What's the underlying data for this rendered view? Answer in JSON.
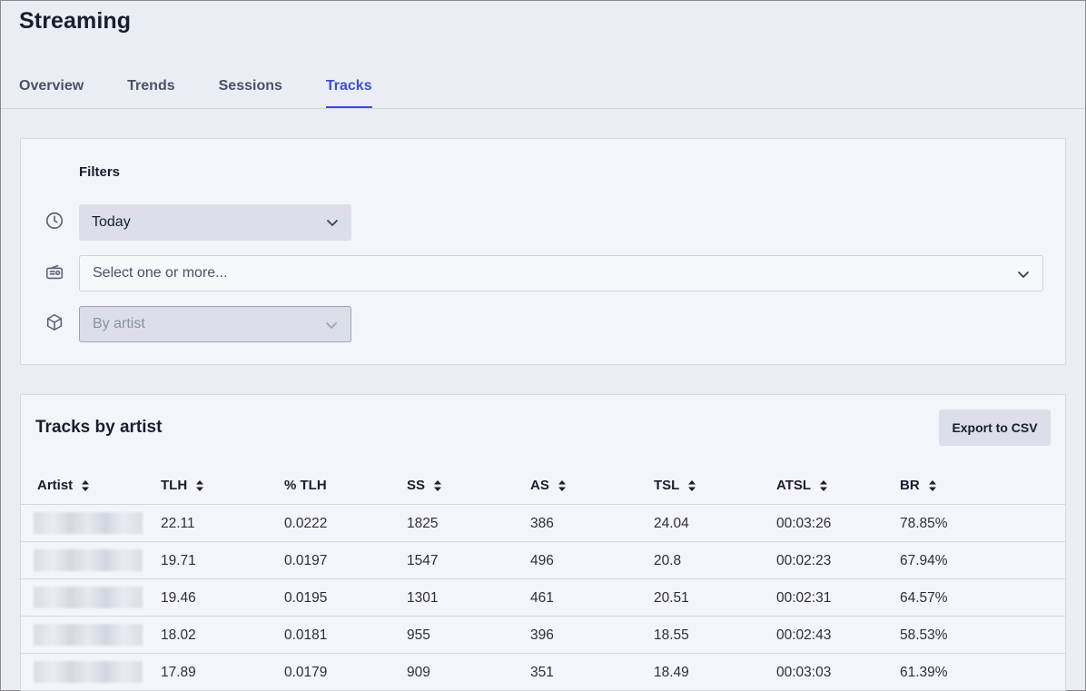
{
  "page": {
    "title": "Streaming"
  },
  "tabs": [
    {
      "label": "Overview"
    },
    {
      "label": "Trends"
    },
    {
      "label": "Sessions"
    },
    {
      "label": "Tracks",
      "active": true
    }
  ],
  "filters": {
    "title": "Filters",
    "date": {
      "value": "Today",
      "icon": "clock-icon"
    },
    "stations": {
      "placeholder": "Select one or more...",
      "icon": "radio-icon"
    },
    "group": {
      "value": "By artist",
      "icon": "cube-icon",
      "disabled": true
    }
  },
  "table": {
    "title": "Tracks by artist",
    "export_label": "Export to CSV",
    "columns": [
      {
        "label": "Artist",
        "sortable": true
      },
      {
        "label": "TLH",
        "sortable": true
      },
      {
        "label": "% TLH",
        "sortable": false
      },
      {
        "label": "SS",
        "sortable": true
      },
      {
        "label": "AS",
        "sortable": true
      },
      {
        "label": "TSL",
        "sortable": true
      },
      {
        "label": "ATSL",
        "sortable": true
      },
      {
        "label": "BR",
        "sortable": true
      }
    ],
    "rows": [
      [
        "",
        "22.11",
        "0.0222",
        "1825",
        "386",
        "24.04",
        "00:03:26",
        "78.85%"
      ],
      [
        "",
        "19.71",
        "0.0197",
        "1547",
        "496",
        "20.8",
        "00:02:23",
        "67.94%"
      ],
      [
        "",
        "19.46",
        "0.0195",
        "1301",
        "461",
        "20.51",
        "00:02:31",
        "64.57%"
      ],
      [
        "",
        "18.02",
        "0.0181",
        "955",
        "396",
        "18.55",
        "00:02:43",
        "58.53%"
      ],
      [
        "",
        "17.89",
        "0.0179",
        "909",
        "351",
        "18.49",
        "00:03:03",
        "61.39%"
      ]
    ]
  },
  "colors": {
    "accent": "#3b4fd8",
    "background": "#ebedf5",
    "card": "#f4f5fa"
  }
}
